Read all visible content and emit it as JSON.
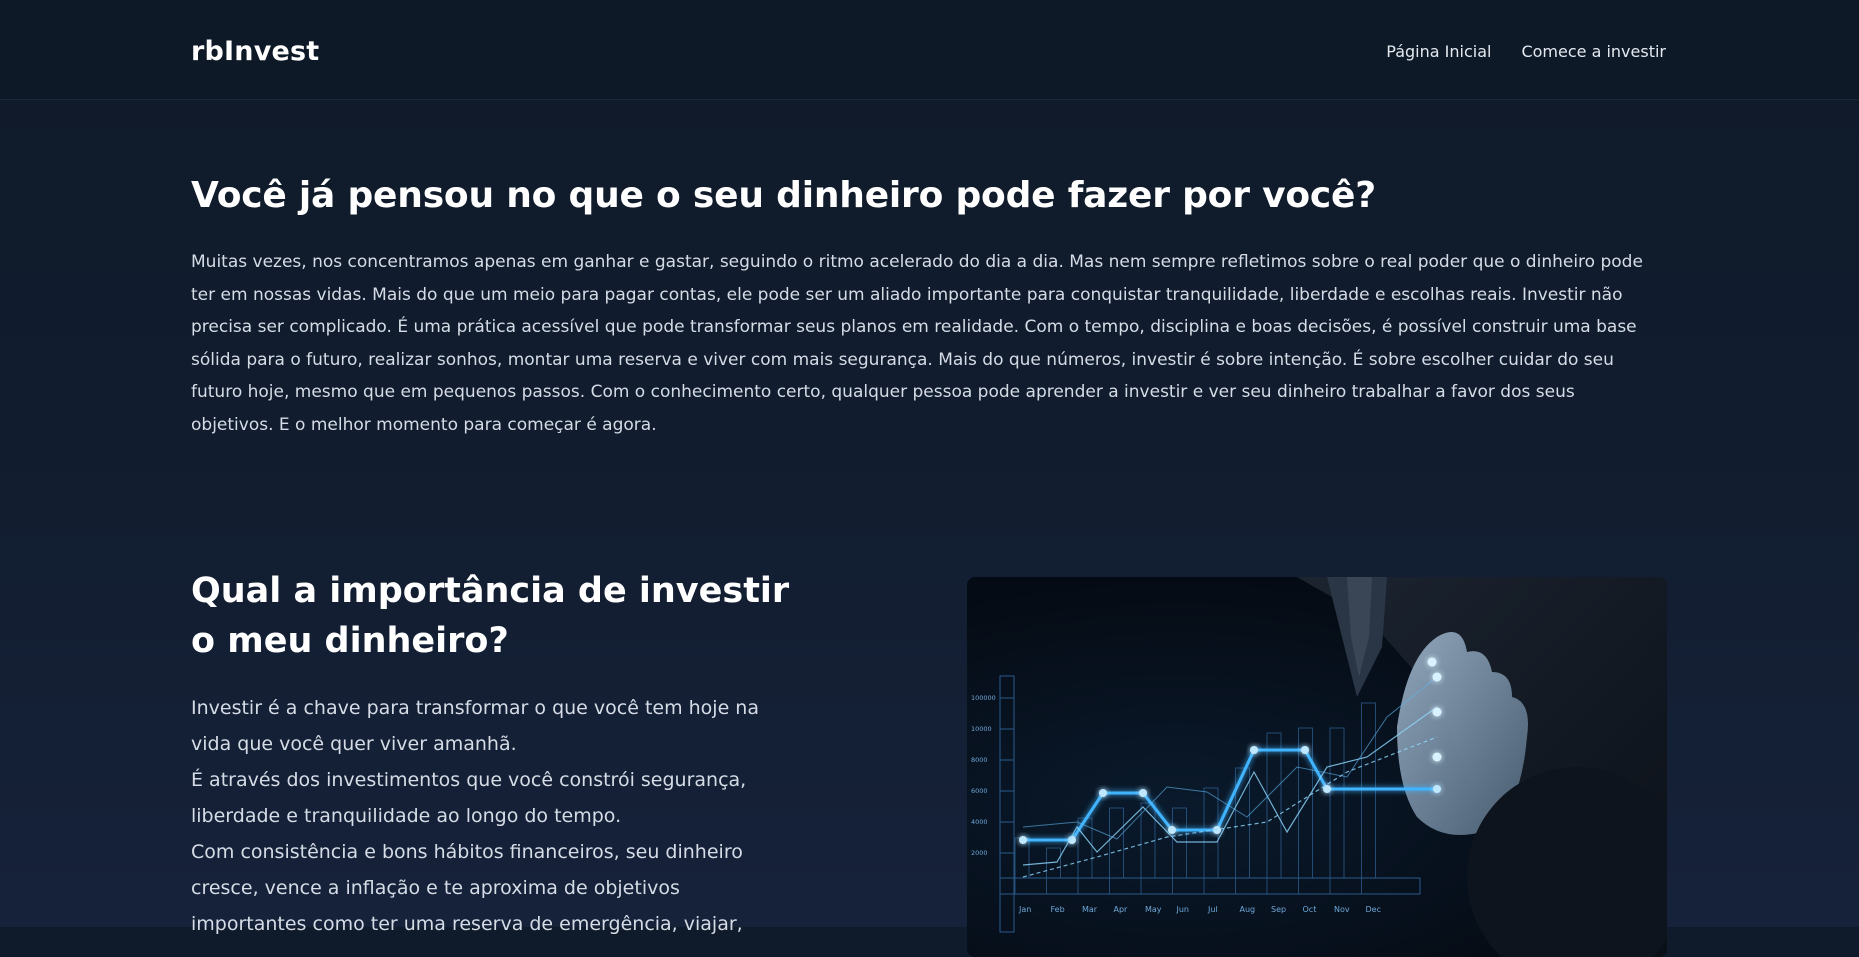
{
  "navbar": {
    "brand": "rbInvest",
    "links": [
      "Página Inicial",
      "Comece a investir"
    ]
  },
  "intro": {
    "heading": "Você já pensou no que o seu dinheiro pode fazer por você?",
    "paragraph": "Muitas vezes, nos concentramos apenas em ganhar e gastar, seguindo o ritmo acelerado do dia a dia. Mas nem sempre refletimos sobre o real poder que o dinheiro pode ter em nossas vidas. Mais do que um meio para pagar contas, ele pode ser um aliado importante para conquistar tranquilidade, liberdade e escolhas reais. Investir não precisa ser complicado. É uma prática acessível que pode transformar seus planos em realidade. Com o tempo, disciplina e boas decisões, é possível construir uma base sólida para o futuro, realizar sonhos, montar uma reserva e viver com mais segurança. Mais do que números, investir é sobre intenção. É sobre escolher cuidar do seu futuro hoje, mesmo que em pequenos passos. Com o conhecimento certo, qualquer pessoa pode aprender a investir e ver seu dinheiro trabalhar a favor dos seus objetivos. E o melhor momento para começar é agora."
  },
  "importance": {
    "heading": "Qual a importância de investir o meu dinheiro?",
    "lines": [
      "Investir é a chave para transformar o que você tem hoje na vida que você quer viver amanhã.",
      "É através dos investimentos que você constrói segurança, liberdade e tranquilidade ao longo do tempo.",
      "Com consistência e bons hábitos financeiros, seu dinheiro cresce, vence a inflação e te aproxima de objetivos importantes como ter uma reserva de emergência, viajar,"
    ]
  },
  "image": {
    "y_ticks": [
      "100000",
      "10000",
      "8000",
      "6000",
      "4000",
      "2000"
    ],
    "months": [
      "Jan",
      "Feb",
      "Mar",
      "Apr",
      "May",
      "Jun",
      "Jul",
      "Aug",
      "Sep",
      "Oct",
      "Nov",
      "Dec"
    ],
    "colors": {
      "glow": "#3fb4ff",
      "line": "#8fd8ff",
      "grid": "#2a5a8a"
    }
  }
}
